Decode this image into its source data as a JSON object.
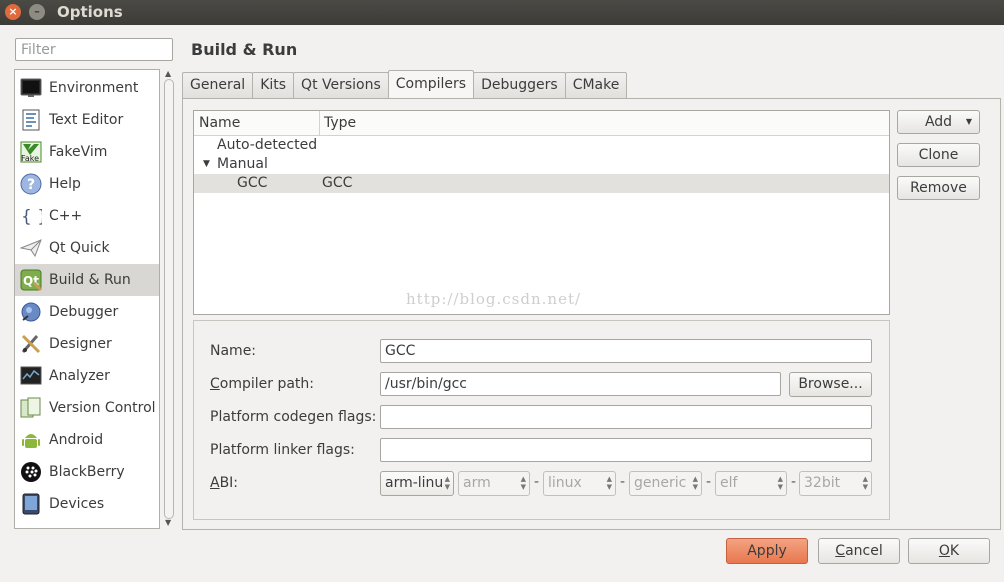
{
  "window": {
    "title": "Options"
  },
  "filter": {
    "placeholder": "Filter"
  },
  "categories": [
    {
      "label": "Environment",
      "icon": "monitor-icon"
    },
    {
      "label": "Text Editor",
      "icon": "text-editor-icon"
    },
    {
      "label": "FakeVim",
      "icon": "fakevim-icon"
    },
    {
      "label": "Help",
      "icon": "help-icon"
    },
    {
      "label": "C++",
      "icon": "cpp-braces-icon"
    },
    {
      "label": "Qt Quick",
      "icon": "qtquick-paperplane-icon"
    },
    {
      "label": "Build & Run",
      "icon": "build-run-icon"
    },
    {
      "label": "Debugger",
      "icon": "debugger-bug-icon"
    },
    {
      "label": "Designer",
      "icon": "designer-icon"
    },
    {
      "label": "Analyzer",
      "icon": "analyzer-icon"
    },
    {
      "label": "Version Control",
      "icon": "version-control-icon"
    },
    {
      "label": "Android",
      "icon": "android-icon"
    },
    {
      "label": "BlackBerry",
      "icon": "blackberry-icon"
    },
    {
      "label": "Devices",
      "icon": "devices-icon"
    }
  ],
  "page": {
    "title": "Build & Run"
  },
  "tabs": [
    "General",
    "Kits",
    "Qt Versions",
    "Compilers",
    "Debuggers",
    "CMake"
  ],
  "active_tab": "Compilers",
  "compilers": {
    "columns": [
      "Name",
      "Type"
    ],
    "groups": {
      "auto": "Auto-detected",
      "manual": "Manual"
    },
    "rows": [
      {
        "name": "GCC",
        "type": "GCC"
      }
    ]
  },
  "watermark": "http://blog.csdn.net/",
  "side_buttons": {
    "add": "Add",
    "clone": "Clone",
    "remove": "Remove"
  },
  "details": {
    "name_label": "Name:",
    "name_value": "GCC",
    "path_label_u": "C",
    "path_label_rest": "ompiler path:",
    "path_value": "/usr/bin/gcc",
    "browse": "Browse...",
    "codegen_label": "Platform codegen flags:",
    "codegen_value": "",
    "linker_label": "Platform linker flags:",
    "linker_value": "",
    "abi_label_u": "A",
    "abi_label_rest": "BI:",
    "abi": [
      "arm-linu",
      "arm",
      "linux",
      "generic",
      "elf",
      "32bit"
    ]
  },
  "buttons": {
    "apply": "Apply",
    "cancel_u": "C",
    "cancel_rest": "ancel",
    "ok_u": "O",
    "ok_rest": "K"
  },
  "colors": {
    "apply_accent": "#e8774e",
    "titlebar": "#3c3b37",
    "close_button": "#df6a3e"
  }
}
